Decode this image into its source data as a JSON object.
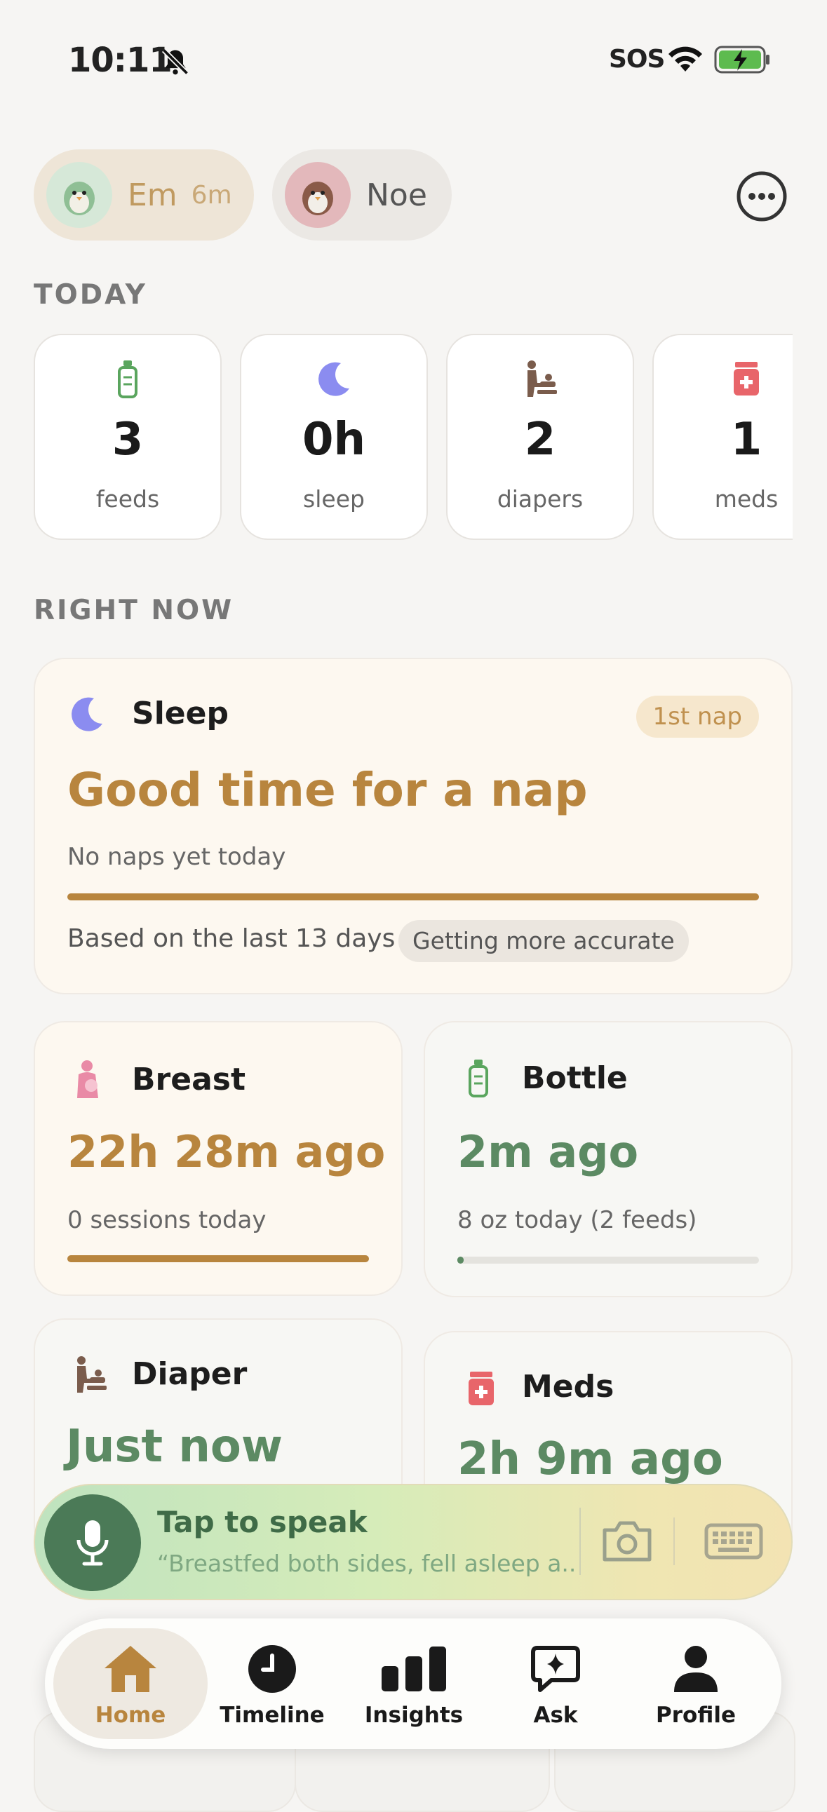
{
  "status_bar": {
    "time": "10:11",
    "sos": "SOS"
  },
  "profiles": [
    {
      "name": "Em",
      "age": "6m"
    },
    {
      "name": "Noe"
    }
  ],
  "today": {
    "label": "TODAY",
    "stats": [
      {
        "icon": "bottle-icon",
        "value": "3",
        "label": "feeds"
      },
      {
        "icon": "moon-icon",
        "value": "0h",
        "label": "sleep"
      },
      {
        "icon": "diaper-icon",
        "value": "2",
        "label": "diapers"
      },
      {
        "icon": "meds-icon",
        "value": "1",
        "label": "meds"
      }
    ]
  },
  "right_now": {
    "label": "RIGHT NOW",
    "sleep": {
      "title": "Sleep",
      "badge": "1st nap",
      "headline": "Good time for a nap",
      "subtitle": "No naps yet today",
      "progress": 1.0,
      "footer": "Based on the last 13 days",
      "footer_badge": "Getting more accurate"
    },
    "breast": {
      "title": "Breast",
      "headline": "22h 28m ago",
      "subtitle": "0 sessions today",
      "progress": 1.0
    },
    "bottle": {
      "title": "Bottle",
      "headline": "2m ago",
      "subtitle": "8 oz today (2 feeds)",
      "progress": 0.02
    },
    "diaper": {
      "title": "Diaper",
      "headline": "Just now"
    },
    "meds": {
      "title": "Meds",
      "headline": "2h 9m ago"
    }
  },
  "voice": {
    "title": "Tap to speak",
    "hint": "“Breastfed both sides, fell asleep a..."
  },
  "tabs": [
    {
      "label": "Home",
      "active": true
    },
    {
      "label": "Timeline"
    },
    {
      "label": "Insights"
    },
    {
      "label": "Ask"
    },
    {
      "label": "Profile"
    }
  ],
  "colors": {
    "accent_gold": "#b8853e",
    "accent_green": "#5c8a63",
    "moon": "#8b8cf0",
    "meds_red": "#e8656a"
  }
}
